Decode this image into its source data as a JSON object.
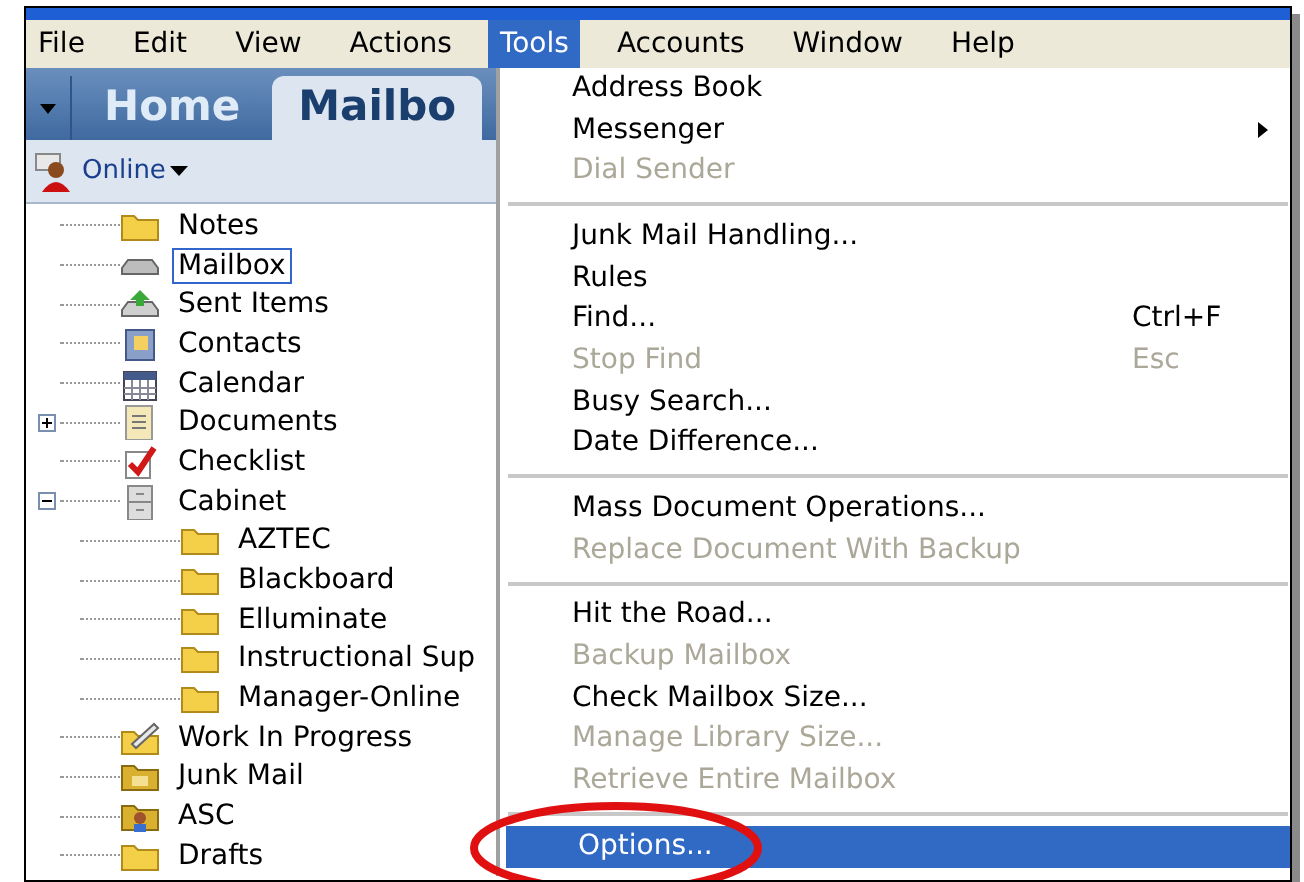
{
  "menu_bar": [
    {
      "label": "File",
      "selected": false
    },
    {
      "label": "Edit",
      "selected": false
    },
    {
      "label": "View",
      "selected": false
    },
    {
      "label": "Actions",
      "selected": false
    },
    {
      "label": "Tools",
      "selected": true
    },
    {
      "label": "Accounts",
      "selected": false
    },
    {
      "label": "Window",
      "selected": false
    },
    {
      "label": "Help",
      "selected": false
    }
  ],
  "tabs": [
    {
      "label": "Home",
      "selected": false
    },
    {
      "label": "Mailbo",
      "selected": true
    }
  ],
  "toolbar": {
    "status_label": "Online"
  },
  "folder_tree": [
    {
      "label": "Notes",
      "kind": "folder",
      "selected": false
    },
    {
      "label": "Mailbox",
      "kind": "tray",
      "selected": true
    },
    {
      "label": "Sent Items",
      "kind": "sent",
      "selected": false
    },
    {
      "label": "Contacts",
      "kind": "contacts",
      "selected": false
    },
    {
      "label": "Calendar",
      "kind": "calendar",
      "selected": false
    },
    {
      "label": "Documents",
      "kind": "documents",
      "selected": false,
      "expanded": false
    },
    {
      "label": "Checklist",
      "kind": "checklist",
      "selected": false
    },
    {
      "label": "Cabinet",
      "kind": "cabinet",
      "selected": false,
      "expanded": true,
      "children": [
        {
          "label": "AZTEC",
          "kind": "folder",
          "selected": false
        },
        {
          "label": "Blackboard",
          "kind": "folder",
          "selected": false
        },
        {
          "label": "Elluminate",
          "kind": "folder",
          "selected": false
        },
        {
          "label": "Instructional Sup",
          "kind": "folder",
          "selected": false
        },
        {
          "label": "Manager-Online",
          "kind": "folder",
          "selected": false
        }
      ]
    },
    {
      "label": "Work In Progress",
      "kind": "work",
      "selected": false
    },
    {
      "label": "Junk Mail",
      "kind": "junk",
      "selected": false
    },
    {
      "label": "ASC",
      "kind": "shared",
      "selected": false
    },
    {
      "label": "Drafts",
      "kind": "folder",
      "selected": false
    }
  ],
  "tools_menu": [
    [
      {
        "label": "Address Book",
        "disabled": false,
        "selected": false
      },
      {
        "label": "Messenger",
        "disabled": false,
        "selected": false,
        "submenu": true
      },
      {
        "label": "Dial Sender",
        "disabled": true,
        "selected": false
      }
    ],
    [
      {
        "label": "Junk Mail Handling...",
        "disabled": false,
        "selected": false
      },
      {
        "label": "Rules",
        "disabled": false,
        "selected": false
      },
      {
        "label": "Find...",
        "disabled": false,
        "selected": false,
        "shortcut": "Ctrl+F"
      },
      {
        "label": "Stop Find",
        "disabled": true,
        "selected": false,
        "shortcut": "Esc"
      },
      {
        "label": "Busy Search...",
        "disabled": false,
        "selected": false
      },
      {
        "label": "Date Difference...",
        "disabled": false,
        "selected": false
      }
    ],
    [
      {
        "label": "Mass Document Operations...",
        "disabled": false,
        "selected": false
      },
      {
        "label": "Replace Document With Backup",
        "disabled": true,
        "selected": false
      }
    ],
    [
      {
        "label": "Hit the Road...",
        "disabled": false,
        "selected": false
      },
      {
        "label": "Backup Mailbox",
        "disabled": true,
        "selected": false
      },
      {
        "label": "Check Mailbox Size...",
        "disabled": false,
        "selected": false
      },
      {
        "label": "Manage Library Size...",
        "disabled": true,
        "selected": false
      },
      {
        "label": "Retrieve Entire Mailbox",
        "disabled": true,
        "selected": false
      }
    ],
    [
      {
        "label": "Options...",
        "disabled": false,
        "selected": true
      }
    ]
  ]
}
